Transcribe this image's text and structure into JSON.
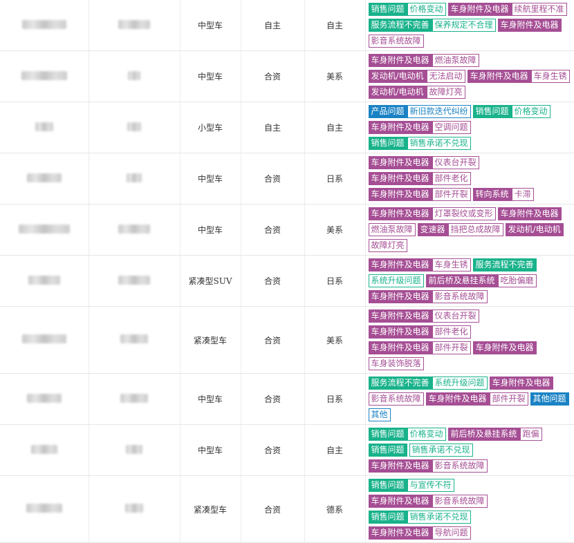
{
  "colors": {
    "sale": "#19b28b",
    "body": "#a54e94",
    "product": "#1a82c4"
  },
  "rows": [
    {
      "size": "中型车",
      "type": "自主",
      "origin": "自主",
      "tags": [
        {
          "cat": "销售问题",
          "sub": "价格变动",
          "cls": "c-sale"
        },
        {
          "cat": "车身附件及电器",
          "sub": "续航里程不准",
          "cls": "c-body"
        },
        {
          "cat": "服务流程不完善",
          "sub": "保养规定不合理",
          "cls": "c-srv"
        },
        {
          "cat": "车身附件及电器",
          "sub": "",
          "cls": "c-body"
        },
        {
          "cat": "",
          "sub": "影音系统故障",
          "cls": "c-body"
        }
      ]
    },
    {
      "size": "中型车",
      "type": "合资",
      "origin": "美系",
      "tags": [
        {
          "cat": "车身附件及电器",
          "sub": "燃油泵故障",
          "cls": "c-body"
        },
        {
          "cat": "发动机/电动机",
          "sub": "无法启动",
          "cls": "c-body"
        },
        {
          "cat": "车身附件及电器",
          "sub": "车身生锈",
          "cls": "c-body"
        },
        {
          "cat": "发动机/电动机",
          "sub": "故障灯亮",
          "cls": "c-body"
        }
      ]
    },
    {
      "size": "小型车",
      "type": "自主",
      "origin": "自主",
      "tags": [
        {
          "cat": "产品问题",
          "sub": "新旧款迭代纠纷",
          "cls": "c-prod"
        },
        {
          "cat": "销售问题",
          "sub": "价格变动",
          "cls": "c-sale"
        },
        {
          "cat": "车身附件及电器",
          "sub": "空调问题",
          "cls": "c-body"
        },
        {
          "cat": "销售问题",
          "sub": "销售承诺不兑现",
          "cls": "c-sale"
        }
      ]
    },
    {
      "size": "中型车",
      "type": "合资",
      "origin": "日系",
      "tags": [
        {
          "cat": "车身附件及电器",
          "sub": "仪表台开裂",
          "cls": "c-body"
        },
        {
          "cat": "车身附件及电器",
          "sub": "部件老化",
          "cls": "c-body"
        },
        {
          "cat": "车身附件及电器",
          "sub": "部件开裂",
          "cls": "c-body"
        },
        {
          "cat": "转向系统",
          "sub": "卡滞",
          "cls": "c-body"
        }
      ]
    },
    {
      "size": "中型车",
      "type": "合资",
      "origin": "美系",
      "tags": [
        {
          "cat": "车身附件及电器",
          "sub": "灯罩裂纹或变形",
          "cls": "c-body"
        },
        {
          "cat": "车身附件及电器",
          "sub": "",
          "cls": "c-body"
        },
        {
          "cat": "",
          "sub": "燃油泵故障",
          "cls": "c-body"
        },
        {
          "cat": "变速器",
          "sub": "挡把总成故障",
          "cls": "c-body"
        },
        {
          "cat": "发动机/电动机",
          "sub": "",
          "cls": "c-body"
        },
        {
          "cat": "",
          "sub": "故障灯亮",
          "cls": "c-body"
        }
      ]
    },
    {
      "size": "紧凑型SUV",
      "type": "合资",
      "origin": "日系",
      "tags": [
        {
          "cat": "车身附件及电器",
          "sub": "车身生锈",
          "cls": "c-body"
        },
        {
          "cat": "服务流程不完善",
          "sub": "",
          "cls": "c-srv"
        },
        {
          "cat": "",
          "sub": "系统升级问题",
          "cls": "c-srv"
        },
        {
          "cat": "前后桥及悬挂系统",
          "sub": "吃胎偏磨",
          "cls": "c-body"
        },
        {
          "cat": "车身附件及电器",
          "sub": "影音系统故障",
          "cls": "c-body"
        }
      ]
    },
    {
      "size": "紧凑型车",
      "type": "合资",
      "origin": "美系",
      "tags": [
        {
          "cat": "车身附件及电器",
          "sub": "仪表台开裂",
          "cls": "c-body"
        },
        {
          "cat": "车身附件及电器",
          "sub": "部件老化",
          "cls": "c-body"
        },
        {
          "cat": "车身附件及电器",
          "sub": "部件开裂",
          "cls": "c-body"
        },
        {
          "cat": "车身附件及电器",
          "sub": "",
          "cls": "c-body"
        },
        {
          "cat": "",
          "sub": "车身装饰脱落",
          "cls": "c-body"
        }
      ]
    },
    {
      "size": "中型车",
      "type": "合资",
      "origin": "日系",
      "tags": [
        {
          "cat": "服务流程不完善",
          "sub": "系统升级问题",
          "cls": "c-srv"
        },
        {
          "cat": "车身附件及电器",
          "sub": "",
          "cls": "c-body"
        },
        {
          "cat": "",
          "sub": "影音系统故障",
          "cls": "c-body"
        },
        {
          "cat": "车身附件及电器",
          "sub": "部件开裂",
          "cls": "c-body"
        },
        {
          "cat": "其他问题",
          "sub": "",
          "cls": "c-oth"
        },
        {
          "cat": "",
          "sub": "其他",
          "cls": "c-oth"
        }
      ]
    },
    {
      "size": "中型车",
      "type": "合资",
      "origin": "自主",
      "tags": [
        {
          "cat": "销售问题",
          "sub": "价格变动",
          "cls": "c-sale"
        },
        {
          "cat": "前后桥及悬挂系统",
          "sub": "跑偏",
          "cls": "c-body"
        },
        {
          "cat": "销售问题",
          "sub": "",
          "cls": "c-sale"
        },
        {
          "cat": "",
          "sub": "销售承诺不兑现",
          "cls": "c-sale"
        },
        {
          "cat": "车身附件及电器",
          "sub": "影音系统故障",
          "cls": "c-body"
        }
      ]
    },
    {
      "size": "紧凑型车",
      "type": "合资",
      "origin": "德系",
      "tags": [
        {
          "cat": "销售问题",
          "sub": "与宣传不符",
          "cls": "c-sale"
        },
        {
          "cat": "车身附件及电器",
          "sub": "影音系统故障",
          "cls": "c-body"
        },
        {
          "cat": "销售问题",
          "sub": "销售承诺不兑现",
          "cls": "c-sale"
        },
        {
          "cat": "车身附件及电器",
          "sub": "导航问题",
          "cls": "c-body"
        }
      ]
    }
  ]
}
